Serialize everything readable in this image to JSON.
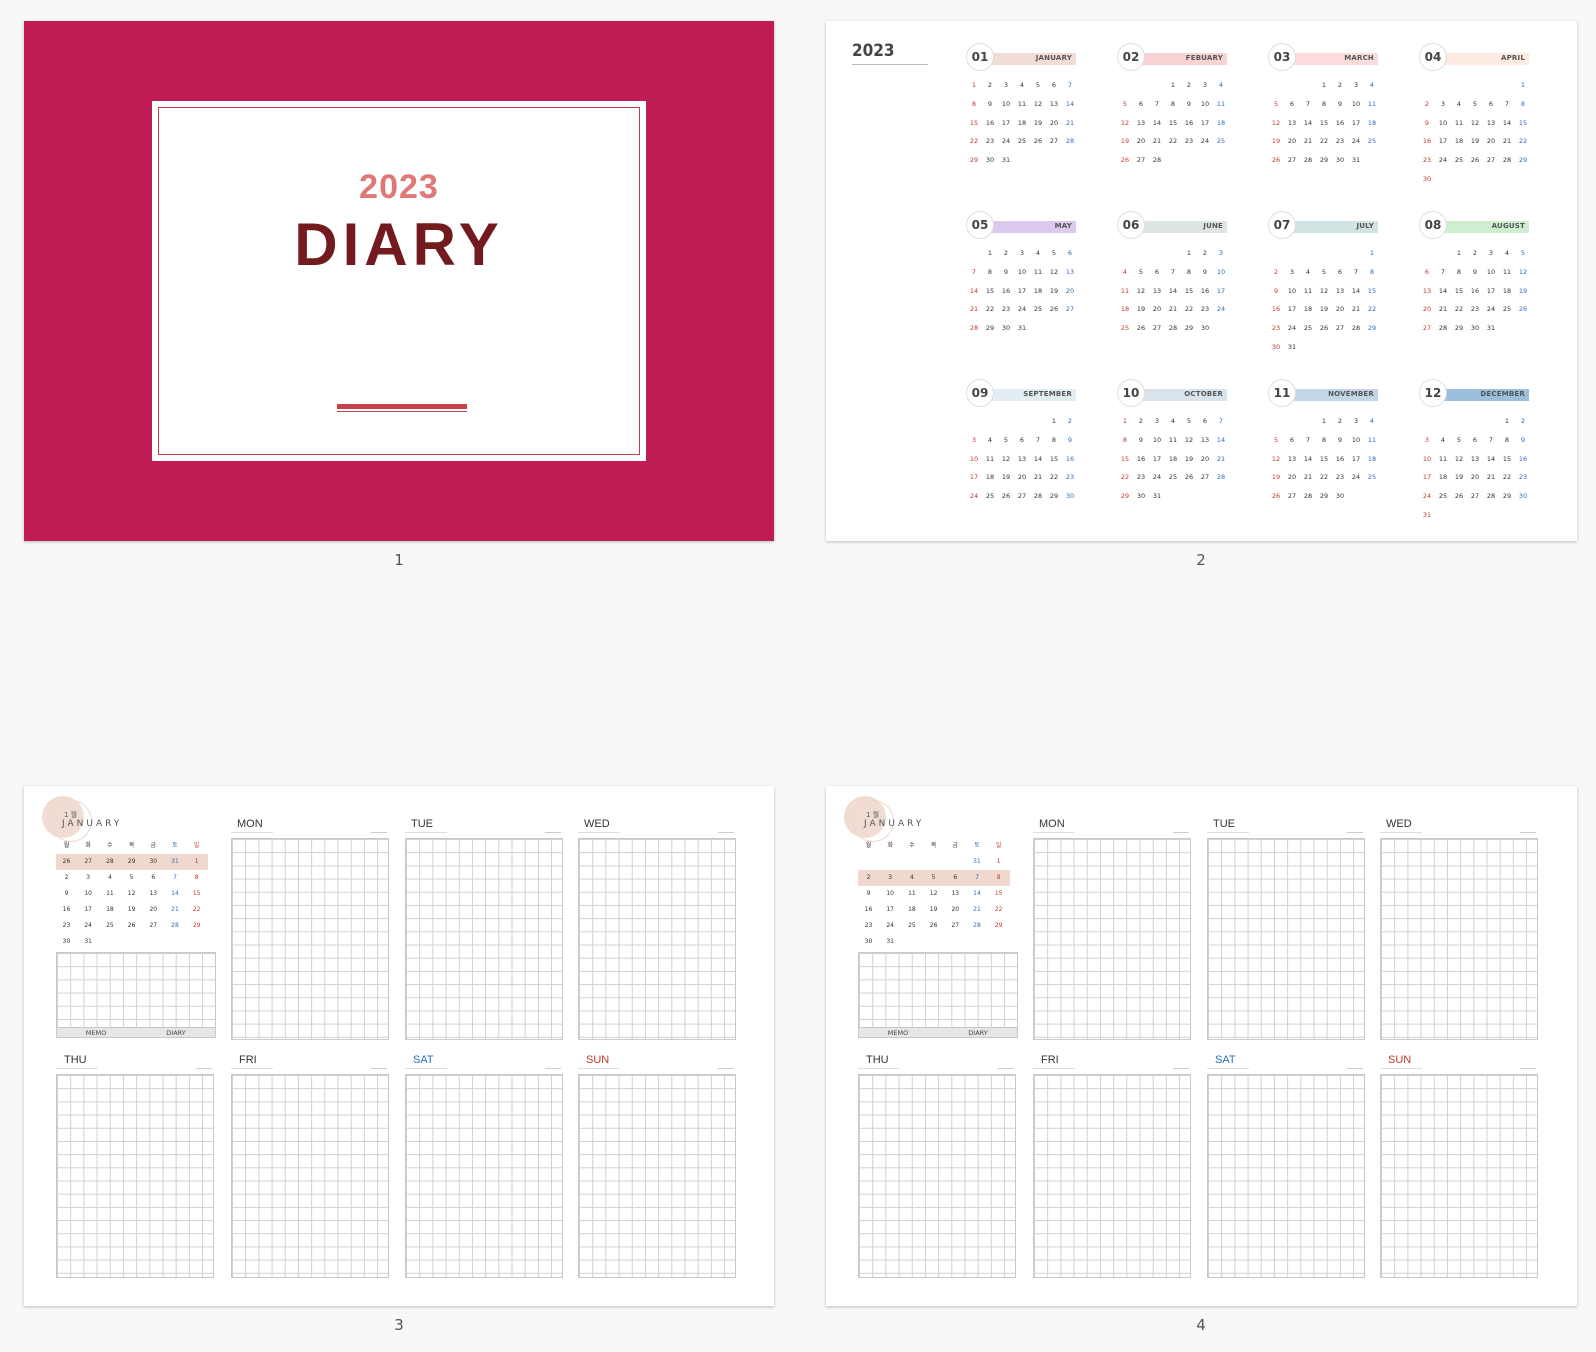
{
  "pages": [
    "1",
    "2",
    "3",
    "4"
  ],
  "cover": {
    "year": "2023",
    "title": "DIARY",
    "colors": {
      "background": "#bf1c55",
      "year": "#e07878",
      "title": "#731a1e",
      "bar": "#c6414a"
    }
  },
  "year_calendar": {
    "title": "2023",
    "months": [
      {
        "num": "01",
        "name": "JANUARY",
        "band": "#f1ddd6",
        "start": 0,
        "days": 31
      },
      {
        "num": "02",
        "name": "FEBUARY",
        "band": "#f9d3d3",
        "start": 3,
        "days": 28
      },
      {
        "num": "03",
        "name": "MARCH",
        "band": "#fbdcdc",
        "start": 3,
        "days": 31
      },
      {
        "num": "04",
        "name": "APRIL",
        "band": "#fdeae0",
        "start": 6,
        "days": 30
      },
      {
        "num": "05",
        "name": "MAY",
        "band": "#dcc9ee",
        "start": 1,
        "days": 31
      },
      {
        "num": "06",
        "name": "JUNE",
        "band": "#dde5e0",
        "start": 4,
        "days": 30
      },
      {
        "num": "07",
        "name": "JULY",
        "band": "#d2e3e3",
        "start": 6,
        "days": 31
      },
      {
        "num": "08",
        "name": "AUGUST",
        "band": "#cdeecf",
        "start": 2,
        "days": 31
      },
      {
        "num": "09",
        "name": "SEPTEMBER",
        "band": "#e2eef1",
        "start": 5,
        "days": 30
      },
      {
        "num": "10",
        "name": "OCTOBER",
        "band": "#d8e3ec",
        "start": 0,
        "days": 31
      },
      {
        "num": "11",
        "name": "NOVEMBER",
        "band": "#c2d6e8",
        "start": 3,
        "days": 30
      },
      {
        "num": "12",
        "name": "DECEMBER",
        "band": "#9cbfdd",
        "start": 5,
        "days": 31
      }
    ],
    "colors": {
      "sunday": "#c0392b",
      "saturday": "#2e6db4",
      "weekday": "#333333"
    }
  },
  "weekly": {
    "month_num": "1 월",
    "month_name": "JANUARY",
    "weekday_headers": [
      "월",
      "화",
      "수",
      "목",
      "금",
      "토",
      "일"
    ],
    "rows": [
      [
        "26",
        "27",
        "28",
        "29",
        "30",
        "31",
        "1"
      ],
      [
        "2",
        "3",
        "4",
        "5",
        "6",
        "7",
        "8"
      ],
      [
        "9",
        "10",
        "11",
        "12",
        "13",
        "14",
        "15"
      ],
      [
        "16",
        "17",
        "18",
        "19",
        "20",
        "21",
        "22"
      ],
      [
        "23",
        "24",
        "25",
        "26",
        "27",
        "28",
        "29"
      ],
      [
        "30",
        "31",
        "",
        "",
        "",
        "",
        ""
      ]
    ],
    "memo_label": "MEMO",
    "diary_label": "DIARY",
    "days": [
      "MON",
      "TUE",
      "WED",
      "THU",
      "FRI",
      "SAT",
      "SUN"
    ],
    "colors": {
      "sat": "#2e6db4",
      "sun": "#c0392b",
      "highlight": "#efd9cf"
    }
  },
  "weekly_page3": {
    "highlight_row": 0
  },
  "weekly_page4": {
    "highlight_row": 1,
    "rows": [
      [
        "",
        "",
        "",
        "",
        "",
        "31",
        "1"
      ],
      [
        "2",
        "3",
        "4",
        "5",
        "6",
        "7",
        "8"
      ],
      [
        "9",
        "10",
        "11",
        "12",
        "13",
        "14",
        "15"
      ],
      [
        "16",
        "17",
        "18",
        "19",
        "20",
        "21",
        "22"
      ],
      [
        "23",
        "24",
        "25",
        "26",
        "27",
        "28",
        "29"
      ],
      [
        "30",
        "31",
        "",
        "",
        "",
        "",
        ""
      ]
    ]
  }
}
